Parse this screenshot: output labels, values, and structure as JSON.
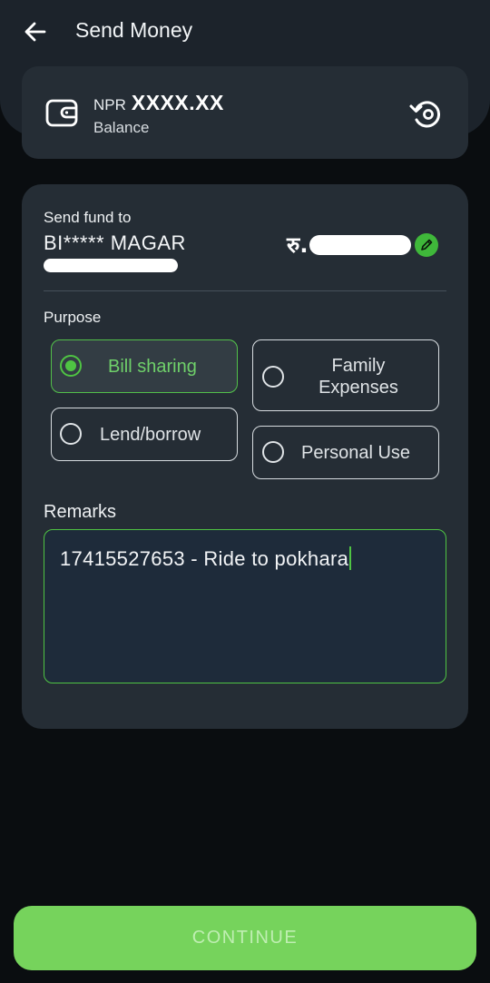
{
  "header": {
    "title": "Send Money",
    "back_icon": "arrow-left-icon"
  },
  "balance": {
    "currency": "NPR",
    "amount": "XXXX.XX",
    "label": "Balance",
    "wallet_icon": "wallet-icon",
    "refresh_icon": "refresh-icon"
  },
  "recipient": {
    "label": "Send fund to",
    "name": "BI***** MAGAR",
    "amount_symbol": "रु."
  },
  "purpose": {
    "label": "Purpose",
    "options": [
      {
        "label": "Bill sharing",
        "selected": true
      },
      {
        "label_line1": "Family",
        "label_line2": "Expenses",
        "selected": false
      },
      {
        "label": "Lend/borrow",
        "selected": false
      },
      {
        "label": "Personal Use",
        "selected": false
      }
    ]
  },
  "remarks": {
    "label": "Remarks",
    "value": "17415527653 - Ride to pokhara"
  },
  "continue_label": "CONTINUE",
  "colors": {
    "accent": "#4fc443",
    "button": "#76d35c",
    "card": "#252d35",
    "background": "#0a0d10"
  }
}
